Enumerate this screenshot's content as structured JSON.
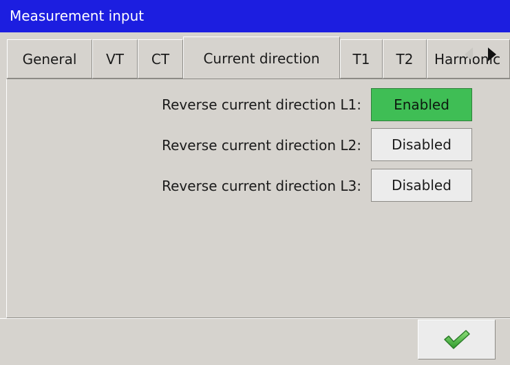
{
  "window": {
    "title": "Measurement input"
  },
  "tabs": [
    {
      "label": "General"
    },
    {
      "label": "VT"
    },
    {
      "label": "CT"
    },
    {
      "label": "Current direction"
    },
    {
      "label": "T1"
    },
    {
      "label": "T2"
    },
    {
      "label": "Harmonic"
    }
  ],
  "active_tab": "Current direction",
  "settings": [
    {
      "label": "Reverse current direction L1:",
      "value": "Enabled"
    },
    {
      "label": "Reverse current direction L2:",
      "value": "Disabled"
    },
    {
      "label": "Reverse current direction L3:",
      "value": "Disabled"
    }
  ],
  "icons": {
    "tab_scroll_left": "triangle-left-icon",
    "tab_scroll_right": "triangle-right-icon",
    "ok": "checkmark-icon"
  },
  "colors": {
    "title_bar": "#1c1ee0",
    "enabled": "#3fbe55",
    "background": "#d6d3ce"
  }
}
